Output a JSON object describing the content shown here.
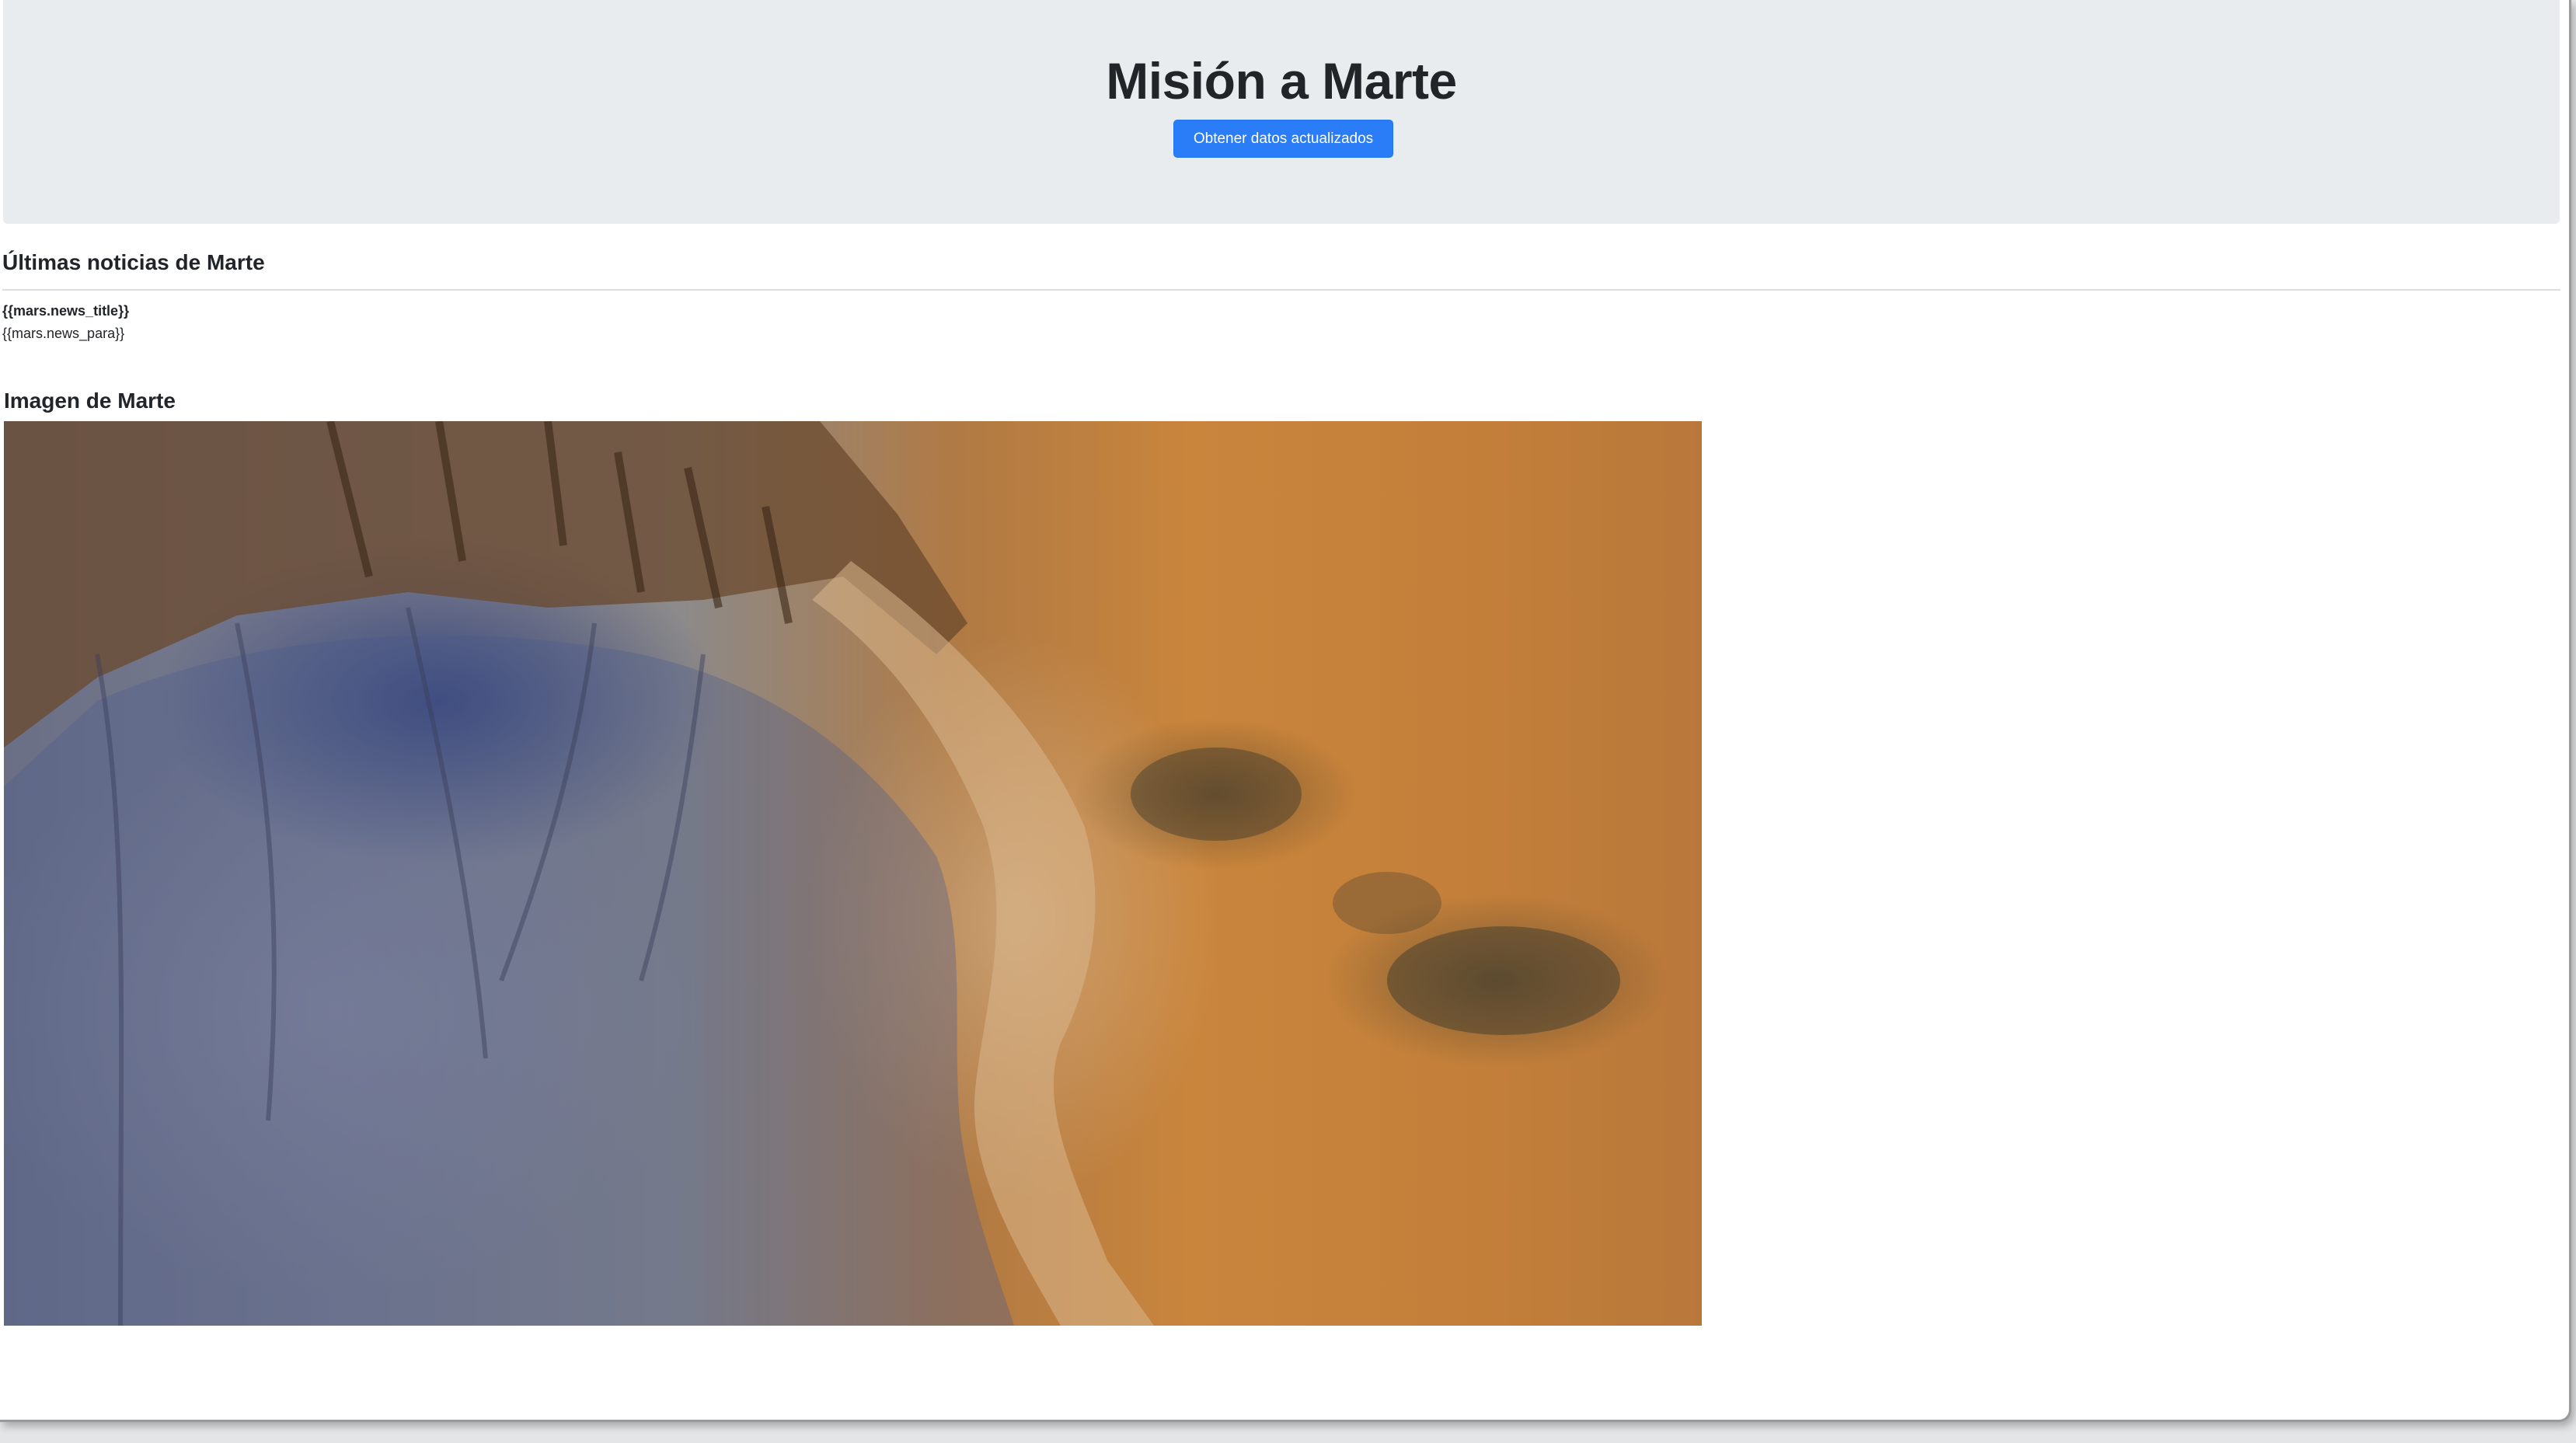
{
  "header": {
    "title": "Misión a Marte",
    "refresh_button_label": "Obtener datos actualizados"
  },
  "news": {
    "heading": "Últimas noticias de Marte",
    "title": "{{mars.news_title}}",
    "paragraph": "{{mars.news_para}}"
  },
  "image_section": {
    "heading": "Imagen de Marte",
    "image_alt": "Imagen de Marte"
  },
  "colors": {
    "jumbotron_bg": "#e9ecef",
    "button_bg": "#2b7cf7",
    "text": "#212529"
  }
}
